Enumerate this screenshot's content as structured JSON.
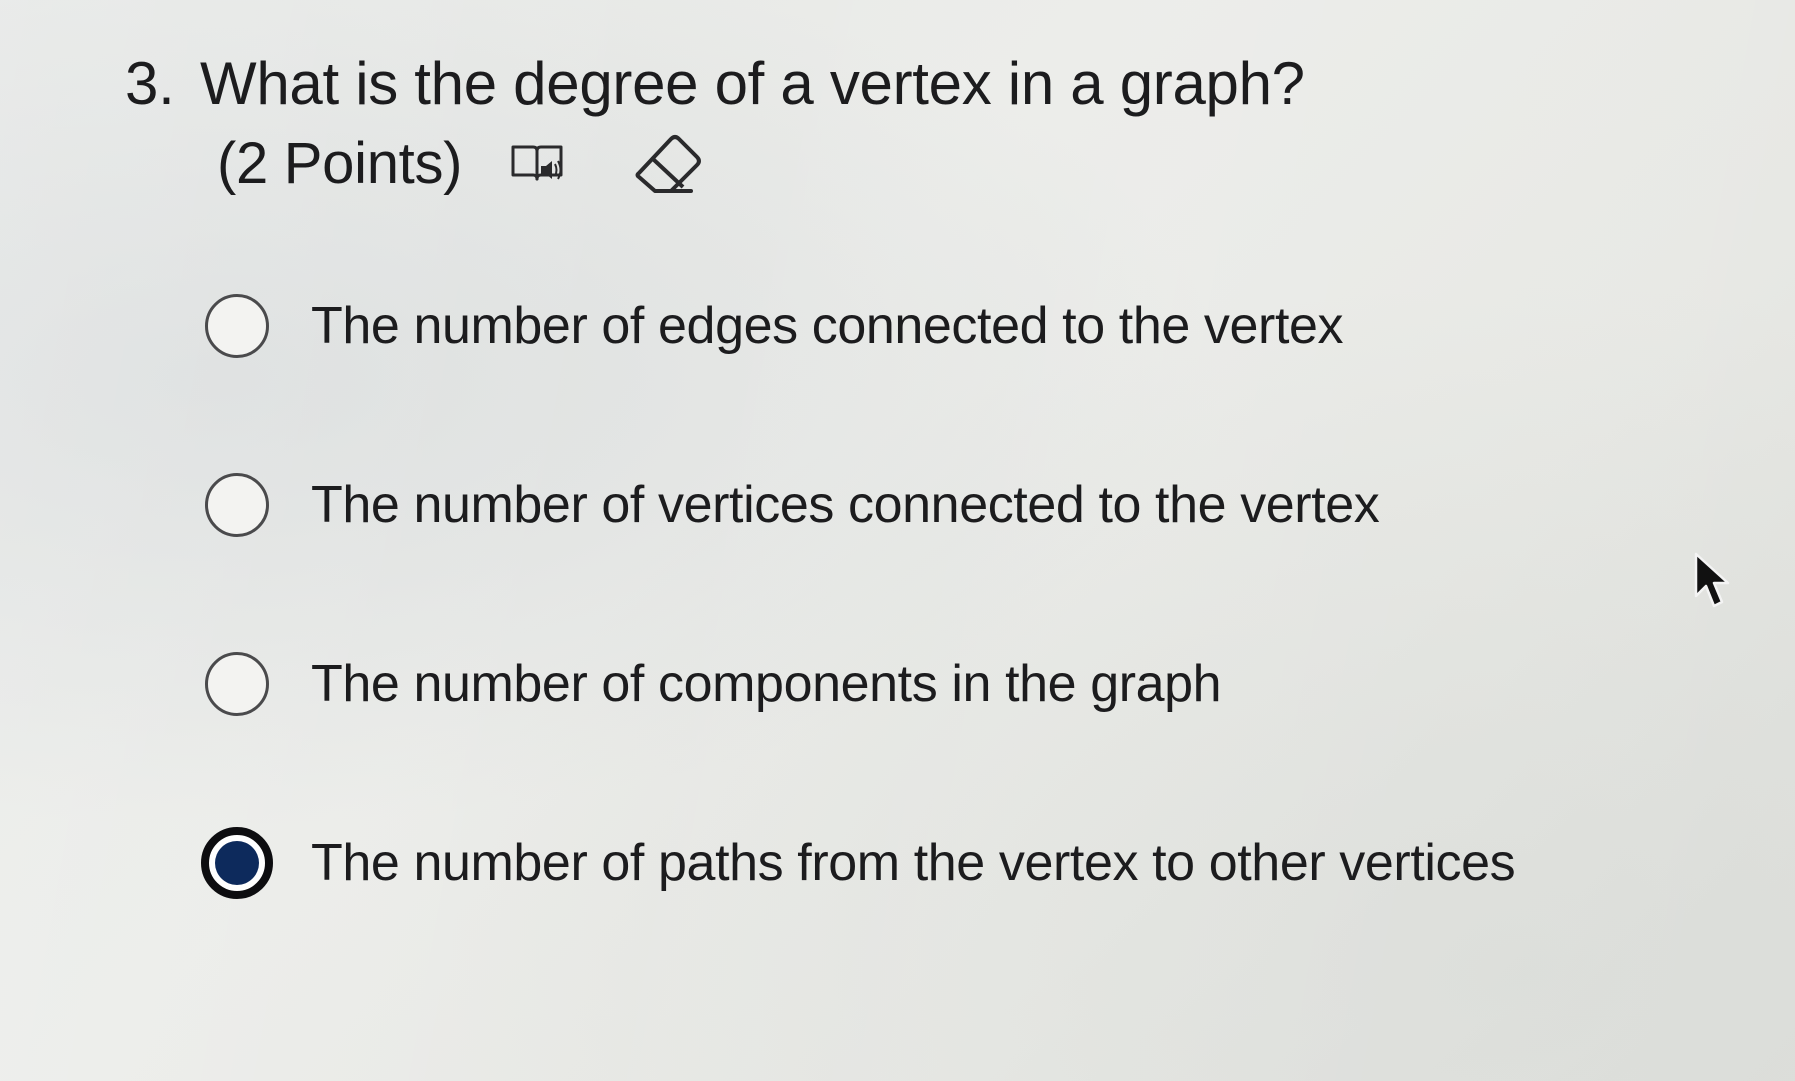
{
  "question": {
    "number": "3.",
    "text": "What is the degree of a vertex in a graph?",
    "points": "(2 Points)",
    "icons": {
      "reader": "immersive-reader-icon",
      "clear": "eraser-icon"
    }
  },
  "options": [
    {
      "label": "The number of edges connected to the vertex",
      "selected": false
    },
    {
      "label": "The number of vertices connected to the vertex",
      "selected": false
    },
    {
      "label": "The number of components in the graph",
      "selected": false
    },
    {
      "label": "The number of paths from the vertex to other vertices",
      "selected": true
    }
  ],
  "colors": {
    "selected_radio_fill": "#0d2a5c",
    "text": "#1c1c1e"
  }
}
